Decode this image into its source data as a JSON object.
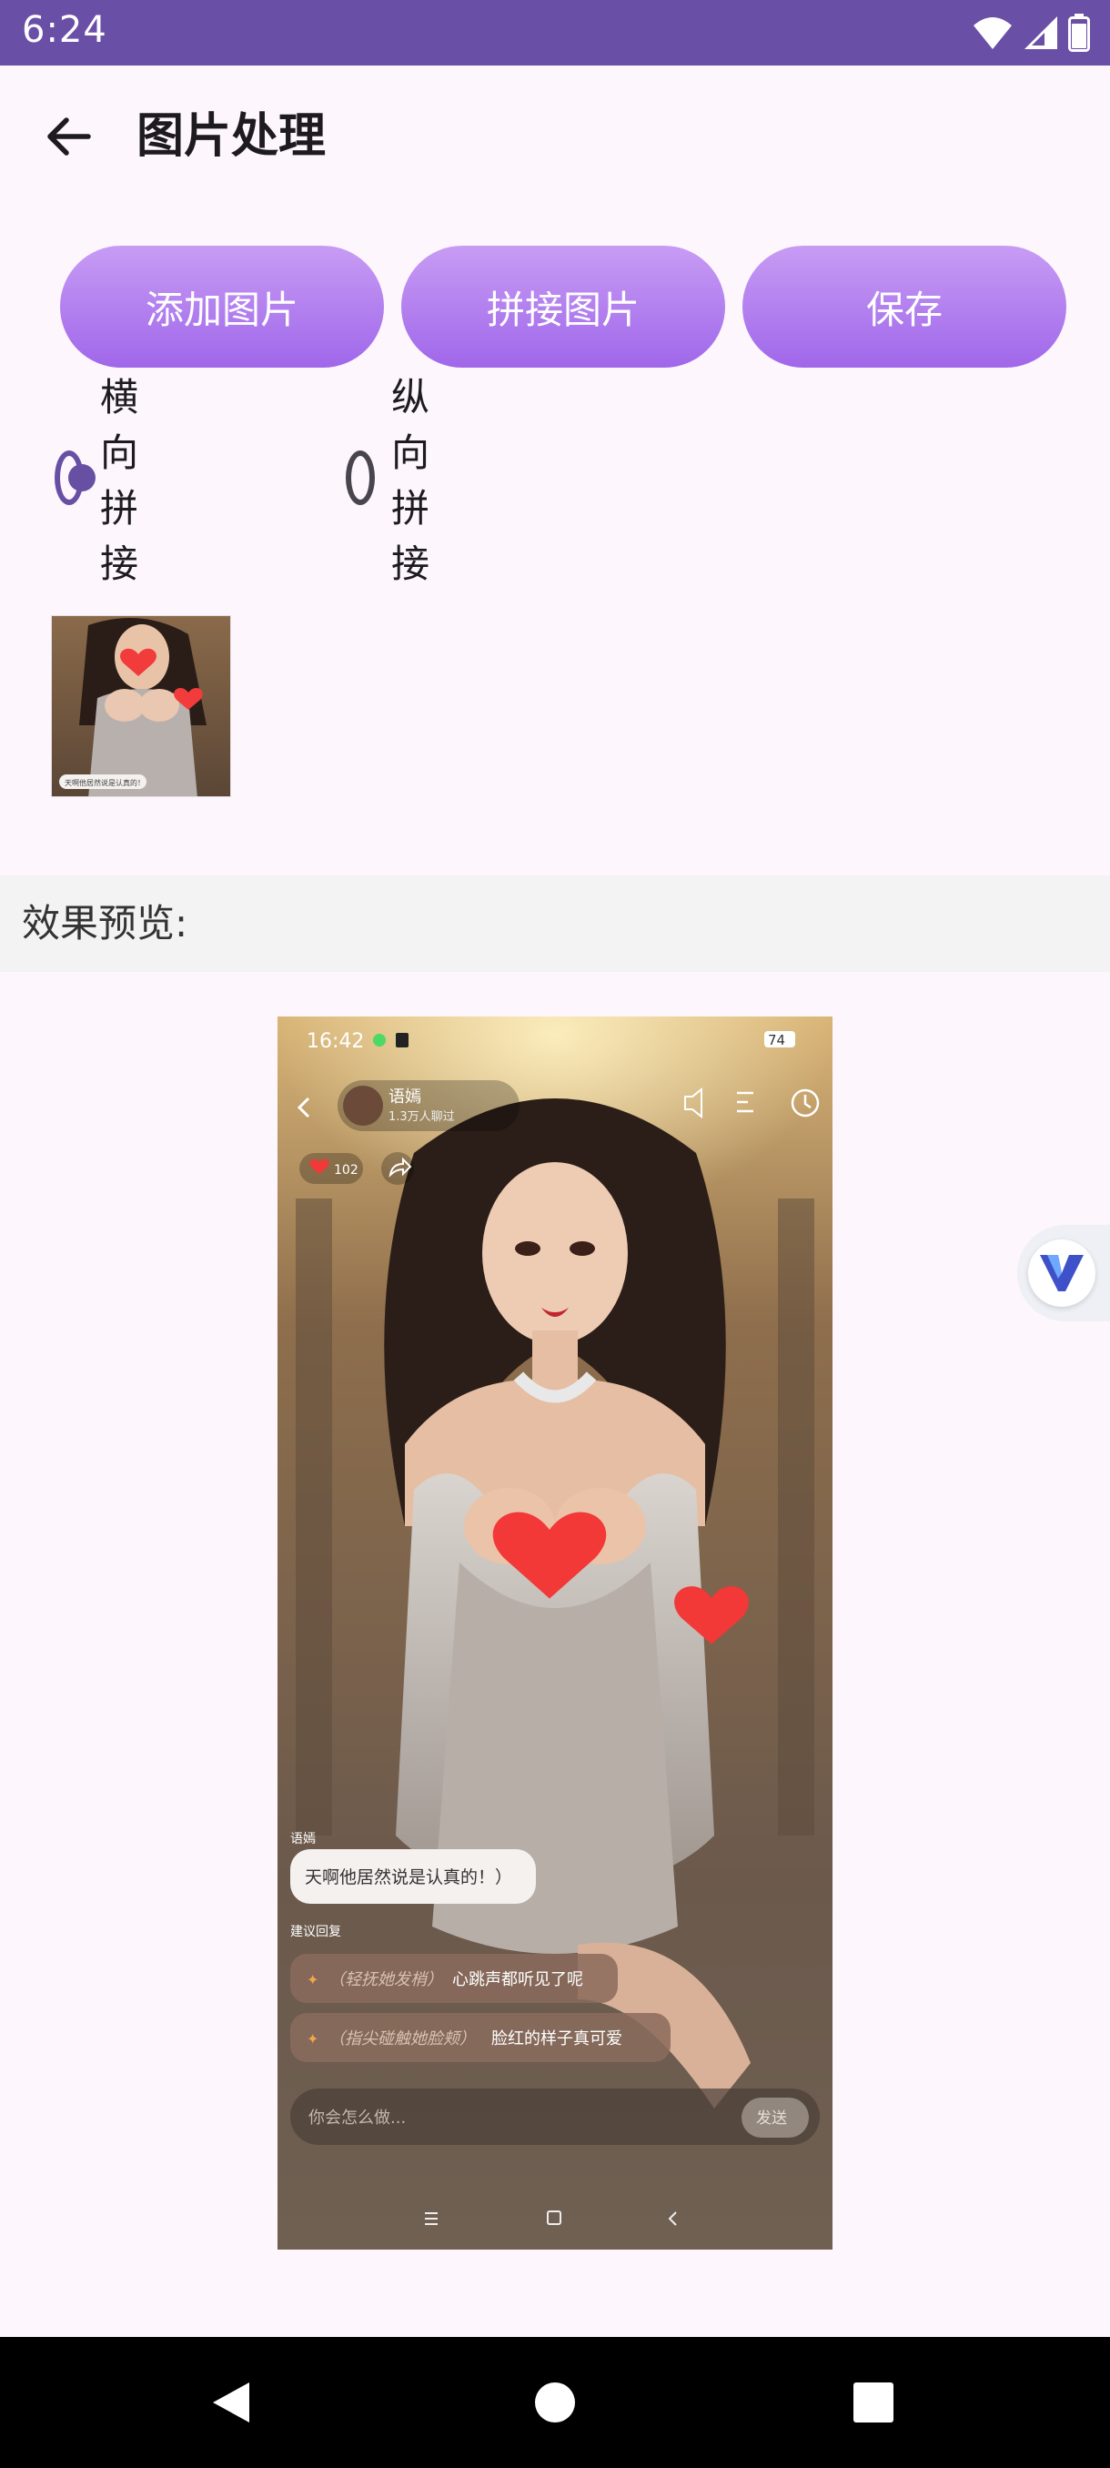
{
  "status_bar": {
    "time": "6:24",
    "battery_level": 0.9
  },
  "app_bar": {
    "title": "图片处理"
  },
  "actions": {
    "add_label": "添加图片",
    "join_label": "拼接图片",
    "save_label": "保存"
  },
  "orientation": {
    "options": [
      {
        "label": "横向拼接",
        "selected": true
      },
      {
        "label": "纵向拼接",
        "selected": false
      }
    ]
  },
  "thumbnails": {
    "count": 1,
    "caption": "天啊他居然说是认真的！"
  },
  "preview": {
    "label": "效果预览:",
    "screenshot": {
      "time": "16:42",
      "battery": "74",
      "character_name": "语嫣",
      "fans": "1.3万人聊过",
      "likes": "102",
      "speaker": "语嫣",
      "message": "天啊他居然说是认真的！）",
      "suggest_title": "建议回复",
      "suggestions": [
        {
          "hint": "（轻抚她发梢）",
          "text": "心跳声都听见了呢"
        },
        {
          "hint": "（指尖碰触她脸颊）",
          "text": "脸红的样子真可爱"
        }
      ],
      "input_placeholder": "你会怎么做...",
      "send_label": "发送"
    }
  },
  "colors": {
    "accent": "#6750a4",
    "status_bar": "#6a4fa7",
    "button_top": "#c79cf4",
    "button_bottom": "#a067ea",
    "nav_bar": "#000000"
  },
  "icons": [
    "wifi-icon",
    "signal-icon",
    "battery-icon",
    "back-arrow-icon",
    "v-logo-icon",
    "nav-back-icon",
    "nav-home-icon",
    "nav-recents-icon"
  ]
}
